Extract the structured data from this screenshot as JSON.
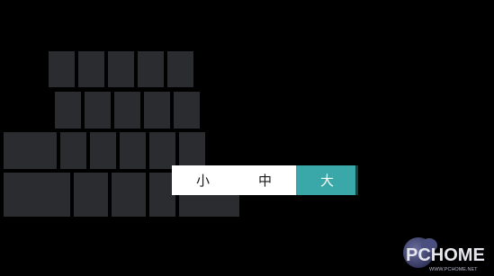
{
  "colors": {
    "background": "#000000",
    "key": "#2b2c2f",
    "selected_option": "#3aa8a9",
    "menu_background": "#ffffff"
  },
  "size_menu": {
    "options": [
      {
        "label": "小",
        "selected": false
      },
      {
        "label": "中",
        "selected": false
      },
      {
        "label": "大",
        "selected": true
      }
    ]
  },
  "watermark": {
    "logo_text": "PCHOME",
    "url": "WWW.PCHOME.NET"
  }
}
